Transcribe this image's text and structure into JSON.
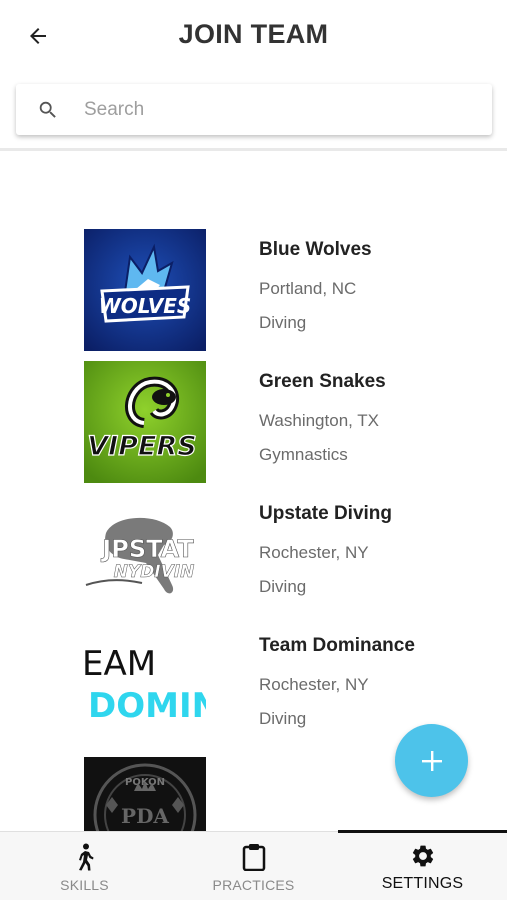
{
  "header": {
    "title": "JOIN TEAM"
  },
  "search": {
    "placeholder": "Search",
    "value": ""
  },
  "teams": [
    {
      "name": "Blue Wolves",
      "location": "Portland, NC",
      "sport": "Diving",
      "logo_text": "WOLVES"
    },
    {
      "name": "Green Snakes",
      "location": "Washington, TX",
      "sport": "Gymnastics",
      "logo_text": "VIPERS"
    },
    {
      "name": "Upstate Diving",
      "location": "Rochester, NY",
      "sport": "Diving",
      "logo_text_1": "JPSTAT",
      "logo_text_2": "NYDIVIN"
    },
    {
      "name": "Team Dominance",
      "location": "Rochester, NY",
      "sport": "Diving",
      "logo_text_1": "EAM",
      "logo_text_2": "DOMIN."
    },
    {
      "name": "",
      "location": "",
      "sport": "",
      "logo_text_1": "POKON",
      "logo_text_2": "PDA"
    }
  ],
  "fab": {
    "label": "+"
  },
  "bottom_nav": [
    {
      "label": "SKILLS",
      "icon": "walking-person-icon",
      "active": false
    },
    {
      "label": "PRACTICES",
      "icon": "clipboard-icon",
      "active": false
    },
    {
      "label": "SETTINGS",
      "icon": "gear-icon",
      "active": true
    }
  ],
  "colors": {
    "accent": "#4dc3ea",
    "active_nav": "#111111",
    "inactive_nav": "#8a8a8a"
  }
}
